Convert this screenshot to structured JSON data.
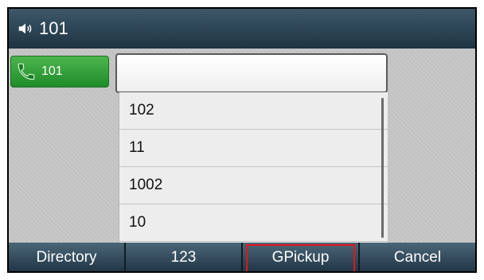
{
  "titlebar": {
    "icon": "speaker-icon",
    "label": "101"
  },
  "line_key": {
    "icon": "phone-handset-icon",
    "label": "101",
    "color": "#2e9e3a"
  },
  "input": {
    "value": ""
  },
  "list": {
    "items": [
      "102",
      "11",
      "1002",
      "10"
    ]
  },
  "softkeys": [
    "Directory",
    "123",
    "GPickup",
    "Cancel"
  ],
  "highlight": {
    "key": "GPickup",
    "color": "#e0161b"
  }
}
